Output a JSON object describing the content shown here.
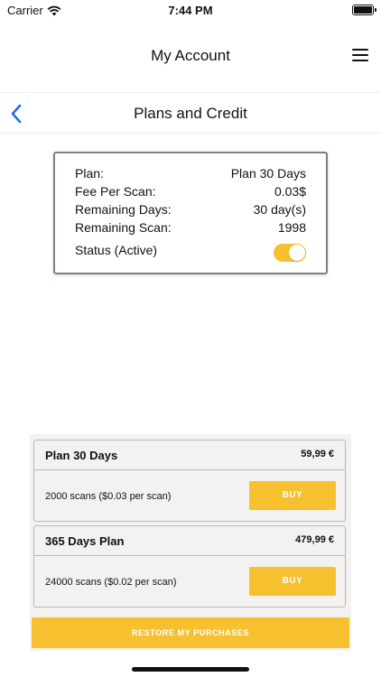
{
  "status_bar": {
    "carrier": "Carrier",
    "time": "7:44 PM"
  },
  "header": {
    "title": "My Account"
  },
  "subheader": {
    "title": "Plans and Credit"
  },
  "account": {
    "rows": [
      {
        "label": "Plan:",
        "value": "Plan 30 Days"
      },
      {
        "label": "Fee Per Scan:",
        "value": "0.03$"
      },
      {
        "label": "Remaining Days:",
        "value": "30 day(s)"
      },
      {
        "label": "Remaining Scan:",
        "value": "1998"
      }
    ],
    "status_label": "Status (Active)",
    "status_active": true
  },
  "plans": [
    {
      "name": "Plan 30 Days",
      "price": "59,99 €",
      "description": "2000 scans ($0.03 per scan)",
      "button": "BUY"
    },
    {
      "name": "365 Days Plan",
      "price": "479,99 €",
      "description": "24000 scans ($0.02 per scan)",
      "button": "BUY"
    }
  ],
  "restore_label": "RESTORE MY PURCHASES",
  "colors": {
    "accent": "#f6c02f",
    "back_arrow": "#1a73e8",
    "card_border": "#7a8092",
    "panel_bg": "#f4f1f1"
  }
}
